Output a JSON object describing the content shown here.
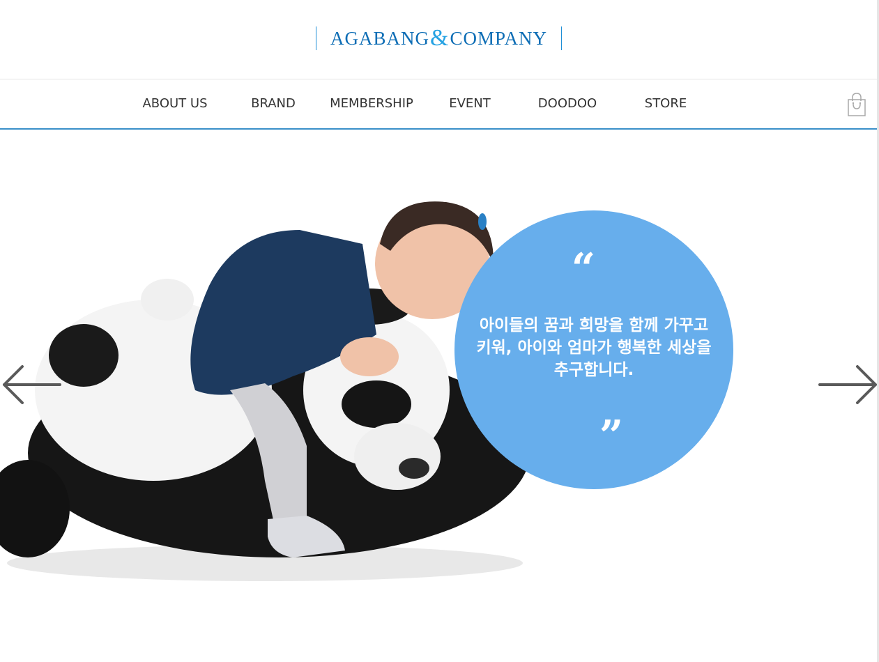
{
  "brand": {
    "name_left": "AGABANG",
    "ampersand": "&",
    "name_right": "COMPANY"
  },
  "nav": {
    "items": [
      {
        "label": "ABOUT US"
      },
      {
        "label": "BRAND"
      },
      {
        "label": "MEMBERSHIP"
      },
      {
        "label": "EVENT"
      },
      {
        "label": "DOODOO"
      },
      {
        "label": "STORE"
      }
    ],
    "cart_icon": "shopping-bag-icon"
  },
  "hero": {
    "quote_open": "“",
    "quote_close": "”",
    "text": "아이들의 꿈과 희망을 함께 가꾸고 키워, 아이와 엄마가 행복한 세상을 추구합니다.",
    "prev_icon": "arrow-left-icon",
    "next_icon": "arrow-right-icon"
  },
  "colors": {
    "brand_blue": "#0d6db5",
    "accent_blue": "#25a2e3",
    "bubble": "#67aeec",
    "nav_text": "#333333"
  }
}
